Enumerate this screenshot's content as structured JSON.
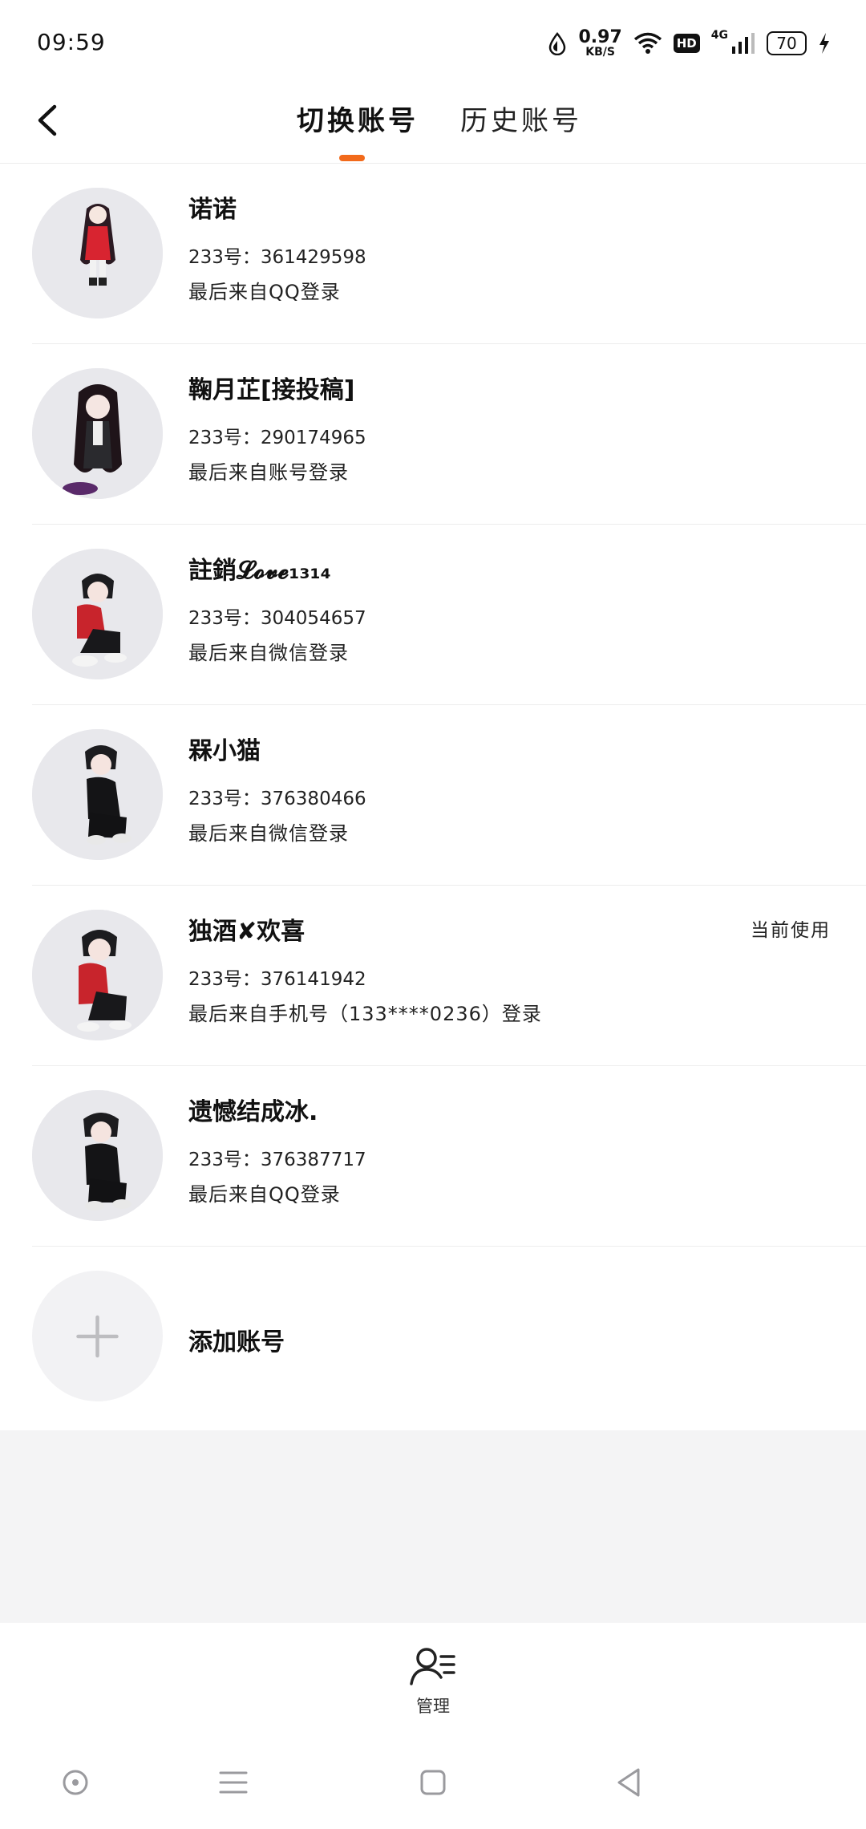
{
  "status_bar": {
    "time": "09:59",
    "net_speed_value": "0.97",
    "net_speed_unit": "KB/S",
    "hd": "HD",
    "network": "4G",
    "battery": "70"
  },
  "header": {
    "tabs": [
      {
        "label": "切换账号",
        "active": true
      },
      {
        "label": "历史账号",
        "active": false
      }
    ],
    "accent_color": "#f26a1b"
  },
  "accounts": [
    {
      "name": "诺诺",
      "id": "233号：361429598",
      "login": "最后来自QQ登录",
      "current": ""
    },
    {
      "name": "鞠月芷[接投稿]",
      "id": "233号：290174965",
      "login": "最后来自账号登录",
      "current": ""
    },
    {
      "name": "註銷𝓛𝓸𝓿𝓮₁₃₁₄",
      "id": "233号：304054657",
      "login": "最后来自微信登录",
      "current": ""
    },
    {
      "name": "槑小猫",
      "id": "233号：376380466",
      "login": "最后来自微信登录",
      "current": ""
    },
    {
      "name": "独酒✘欢喜",
      "id": "233号：376141942",
      "login": "最后来自手机号（133****0236）登录",
      "current": "当前使用"
    },
    {
      "name": "遗憾结成冰.",
      "id": "233号：376387717",
      "login": "最后来自QQ登录",
      "current": ""
    }
  ],
  "add_account": {
    "label": "添加账号",
    "icon": "plus-icon"
  },
  "bottom": {
    "manage_label": "管理",
    "icon": "user-list-icon"
  },
  "nav": {
    "icons": [
      "circle-dot-icon",
      "menu-icon",
      "home-square-icon",
      "back-triangle-icon"
    ]
  }
}
